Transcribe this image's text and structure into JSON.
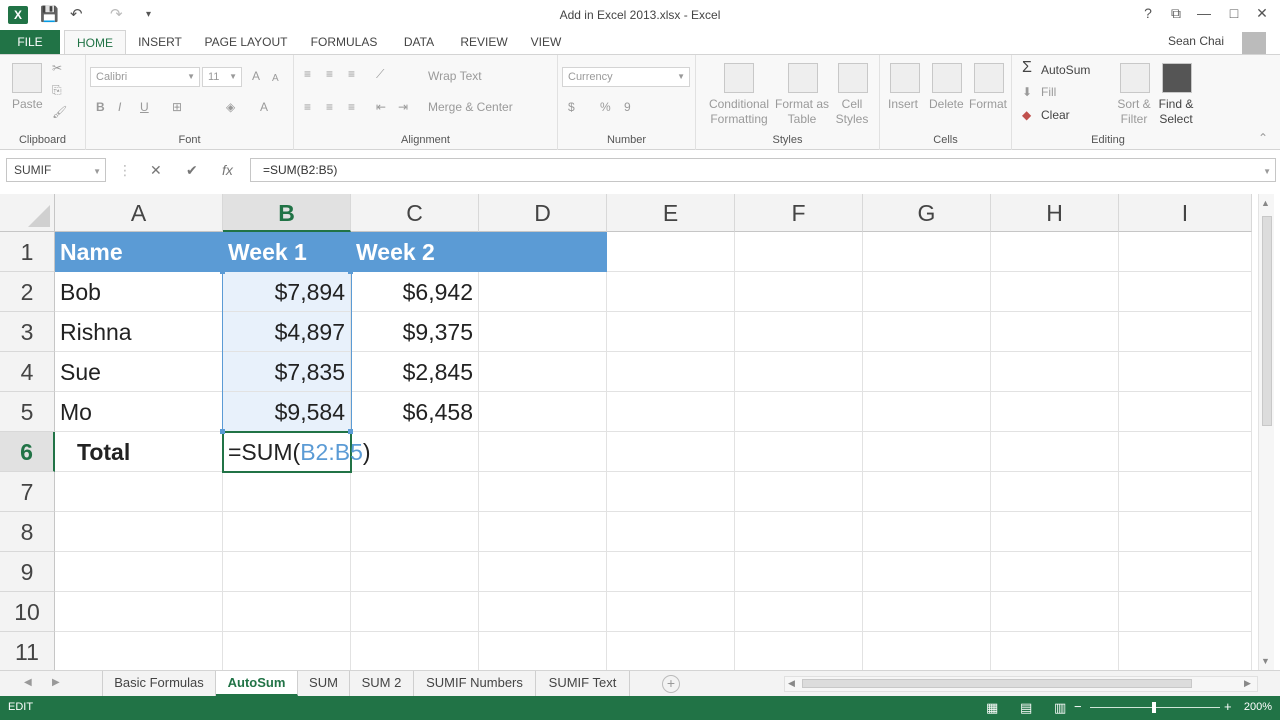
{
  "window": {
    "title": "Add in Excel 2013.xlsx - Excel",
    "help": "?",
    "minimize": "—",
    "maximize": "□",
    "close": "✕"
  },
  "qat": {
    "save": "💾",
    "undo": "↶",
    "redo": "↷",
    "customize": "▾"
  },
  "tabs": {
    "file": "FILE",
    "items": [
      "HOME",
      "INSERT",
      "PAGE LAYOUT",
      "FORMULAS",
      "DATA",
      "REVIEW",
      "VIEW"
    ],
    "active": "HOME",
    "user": "Sean Chai"
  },
  "ribbon": {
    "clipboard": {
      "label": "Clipboard",
      "paste": "Paste"
    },
    "font": {
      "label": "Font",
      "name": "Calibri",
      "size": "11",
      "bold": "B",
      "italic": "I",
      "underline": "U",
      "grow": "A",
      "shrink": "A"
    },
    "alignment": {
      "label": "Alignment",
      "wrap": "Wrap Text",
      "merge": "Merge & Center"
    },
    "number": {
      "label": "Number",
      "format": "Currency",
      "currency": "$",
      "percent": "%",
      "comma": "9"
    },
    "styles": {
      "label": "Styles",
      "conditional_1": "Conditional",
      "conditional_2": "Formatting",
      "table_1": "Format as",
      "table_2": "Table",
      "cell_1": "Cell",
      "cell_2": "Styles"
    },
    "cells": {
      "label": "Cells",
      "insert": "Insert",
      "delete": "Delete",
      "format": "Format"
    },
    "editing": {
      "label": "Editing",
      "autosum": "AutoSum",
      "fill": "Fill",
      "clear": "Clear",
      "sort_1": "Sort &",
      "sort_2": "Filter",
      "find_1": "Find &",
      "find_2": "Select"
    }
  },
  "formula_bar": {
    "name_box": "SUMIF",
    "cancel": "✕",
    "enter": "✔",
    "fx": "fx",
    "content": "=SUM(B2:B5)"
  },
  "grid": {
    "columns": [
      "A",
      "B",
      "C",
      "D",
      "E",
      "F",
      "G",
      "H",
      "I"
    ],
    "selected_column": "B",
    "rows": [
      "1",
      "2",
      "3",
      "4",
      "5",
      "6",
      "7",
      "8",
      "9",
      "10",
      "11"
    ],
    "selected_row": "6",
    "header": {
      "a": "Name",
      "b": "Week 1",
      "c": "Week 2"
    },
    "data": [
      {
        "name": "Bob",
        "week1": "$7,894",
        "week2": "$6,942"
      },
      {
        "name": "Rishna",
        "week1": "$4,897",
        "week2": "$9,375"
      },
      {
        "name": "Sue",
        "week1": "$7,835",
        "week2": "$2,845"
      },
      {
        "name": "Mo",
        "week1": "$9,584",
        "week2": "$6,458"
      }
    ],
    "total_label": "Total",
    "edit": {
      "prefix": "=SUM(",
      "ref": "B2:B5",
      "suffix": ")"
    }
  },
  "sheets": {
    "items": [
      "Basic Formulas",
      "AutoSum",
      "SUM",
      "SUM 2",
      "SUMIF Numbers",
      "SUMIF Text"
    ],
    "active": "AutoSum"
  },
  "status": {
    "mode": "EDIT",
    "zoom": "200%"
  },
  "colors": {
    "accent": "#217346",
    "table_header": "#5b9bd5",
    "range_fill": "#e8f1fb"
  }
}
